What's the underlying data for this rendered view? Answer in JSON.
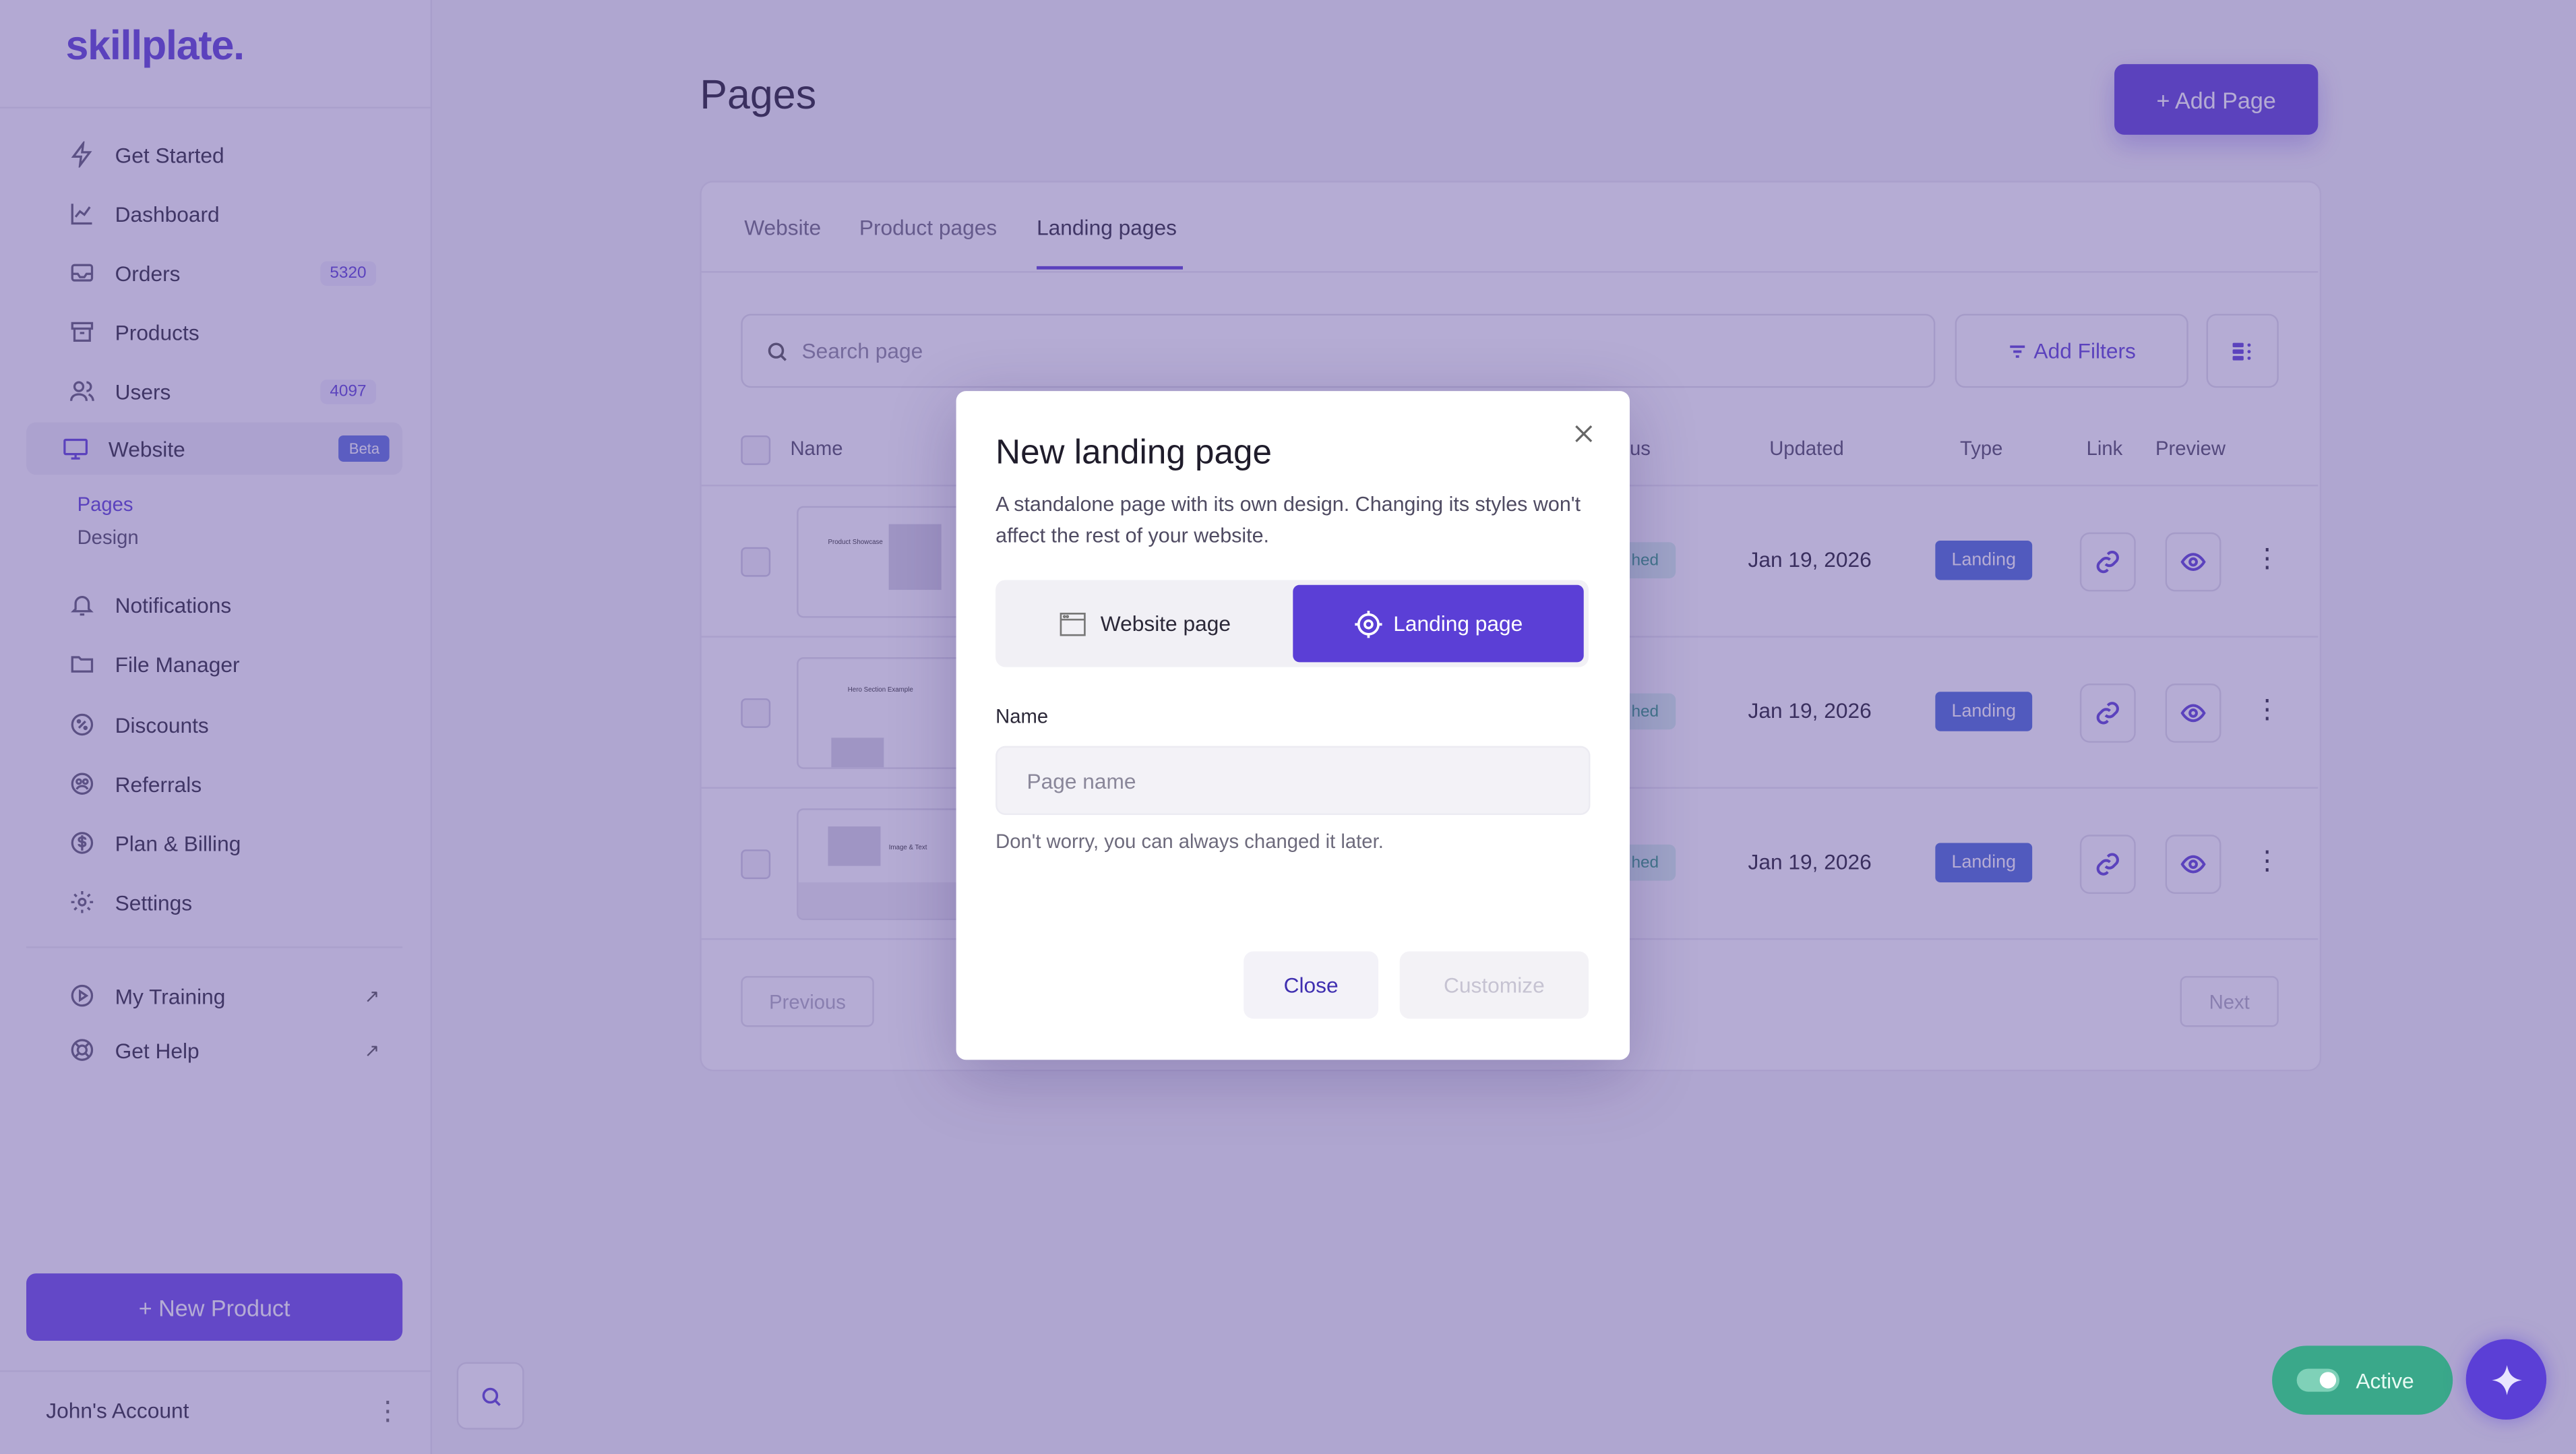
{
  "brand": {
    "logo": "skillplate."
  },
  "sidebar": {
    "items": [
      {
        "label": "Get Started",
        "icon": "bolt-icon"
      },
      {
        "label": "Dashboard",
        "icon": "chart-icon"
      },
      {
        "label": "Orders",
        "icon": "inbox-icon",
        "count": "5320"
      },
      {
        "label": "Products",
        "icon": "box-icon"
      },
      {
        "label": "Users",
        "icon": "users-icon",
        "count": "4097"
      },
      {
        "label": "Website",
        "icon": "monitor-icon",
        "badge": "Beta"
      },
      {
        "label": "Notifications",
        "icon": "bell-icon"
      },
      {
        "label": "File Manager",
        "icon": "folder-icon"
      },
      {
        "label": "Discounts",
        "icon": "discount-icon"
      },
      {
        "label": "Referrals",
        "icon": "referrals-icon"
      },
      {
        "label": "Plan & Billing",
        "icon": "dollar-icon"
      },
      {
        "label": "Settings",
        "icon": "gear-icon"
      }
    ],
    "sub_items": [
      {
        "label": "Pages"
      },
      {
        "label": "Design"
      }
    ],
    "external": [
      {
        "label": "My Training",
        "icon": "play-icon"
      },
      {
        "label": "Get Help",
        "icon": "lifebuoy-icon"
      }
    ],
    "new_product": "+ New Product",
    "account": "John's Account"
  },
  "main": {
    "title": "Pages",
    "add_page": "+ Add Page",
    "tabs": [
      {
        "label": "Website"
      },
      {
        "label": "Product pages"
      },
      {
        "label": "Landing pages"
      }
    ],
    "search_placeholder": "Search page",
    "add_filters": "Add Filters",
    "columns": {
      "name": "Name",
      "status": "us",
      "updated": "Updated",
      "type": "Type",
      "link": "Link",
      "preview": "Preview"
    },
    "rows": [
      {
        "status": "hed",
        "updated": "Jan 19, 2026",
        "type": "Landing",
        "thumb_caption": "Product Showcase"
      },
      {
        "status": "hed",
        "updated": "Jan 19, 2026",
        "type": "Landing",
        "thumb_caption": "Hero Section Example"
      },
      {
        "status": "hed",
        "updated": "Jan 19, 2026",
        "type": "Landing",
        "thumb_caption": "Image & Text"
      }
    ],
    "pager": {
      "prev": "Previous",
      "next": "Next"
    }
  },
  "modal": {
    "title": "New landing page",
    "description": "A standalone page with its own design. Changing its styles won't affect the rest of your website.",
    "options": [
      {
        "label": "Website page",
        "icon": "window-icon"
      },
      {
        "label": "Landing page",
        "icon": "target-icon"
      }
    ],
    "name_label": "Name",
    "name_placeholder": "Page name",
    "name_value": "",
    "hint": "Don't worry, you can always changed it later.",
    "close": "Close",
    "customize": "Customize"
  },
  "status_pill": {
    "label": "Active"
  },
  "colors": {
    "accent": "#5b3fd6",
    "success": "#3aa88a",
    "badge": "#4a6ad8"
  }
}
